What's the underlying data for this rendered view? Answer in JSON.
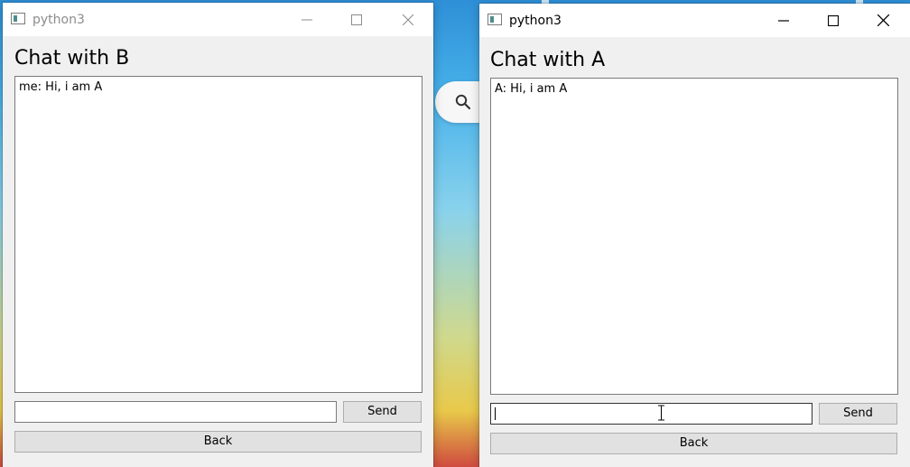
{
  "window_left": {
    "title": "python3",
    "heading": "Chat with B",
    "messages": [
      "me: Hi, i am A"
    ],
    "input_value": "",
    "send_label": "Send",
    "back_label": "Back",
    "active": false
  },
  "window_right": {
    "title": "python3",
    "heading": "Chat with A",
    "messages": [
      "A: Hi, i am A"
    ],
    "input_value": "",
    "send_label": "Send",
    "back_label": "Back",
    "active": true
  },
  "colors": {
    "inactive_title_text": "#8c8c8c",
    "active_title_text": "#000000",
    "inactive_ctrl": "#8c8c8c",
    "active_ctrl": "#000000",
    "window_bg": "#f0f0f0",
    "focus_border": "#333333"
  },
  "icons": {
    "app": "python-window-icon",
    "minimize": "minimize-icon",
    "maximize": "maximize-icon",
    "close": "close-icon",
    "search": "search-icon",
    "text_cursor": "text-cursor-icon"
  }
}
